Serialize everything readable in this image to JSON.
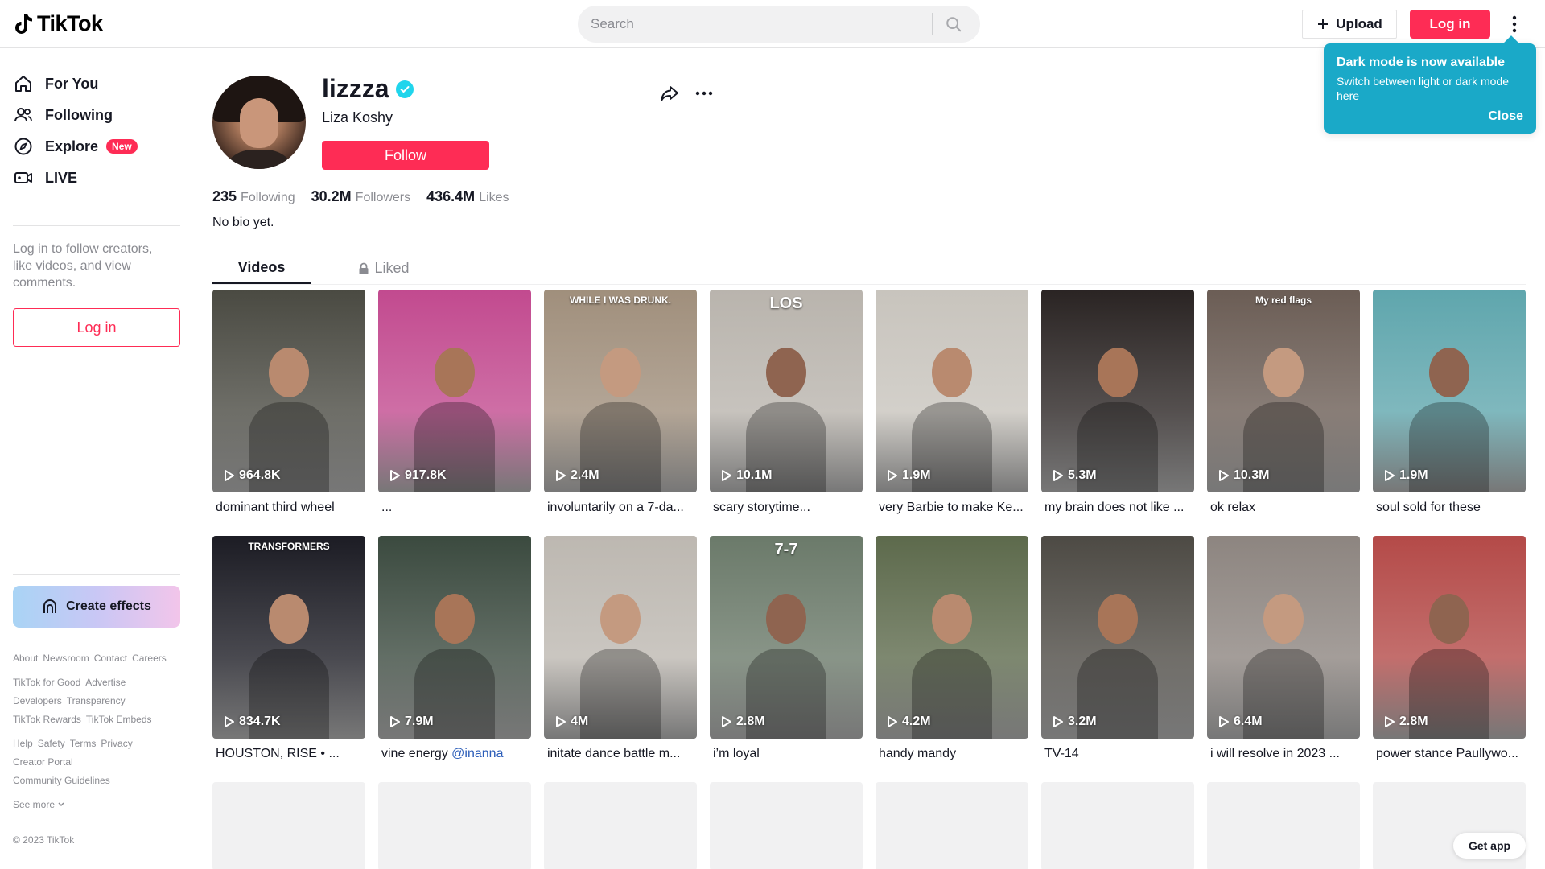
{
  "header": {
    "logo_text": "TikTok",
    "search_placeholder": "Search",
    "upload_label": "Upload",
    "login_label": "Log in"
  },
  "tooltip": {
    "title": "Dark mode is now available",
    "body": "Switch between light or dark mode here",
    "close_label": "Close"
  },
  "sidebar": {
    "nav": [
      {
        "label": "For You",
        "icon": "home-icon"
      },
      {
        "label": "Following",
        "icon": "people-icon"
      },
      {
        "label": "Explore",
        "icon": "compass-icon",
        "badge": "New"
      },
      {
        "label": "LIVE",
        "icon": "live-icon"
      }
    ],
    "login_prompt": "Log in to follow creators, like videos, and view comments.",
    "login_button": "Log in",
    "create_effects": "Create effects",
    "footer_rows": [
      [
        "About",
        "Newsroom",
        "Contact",
        "Careers"
      ],
      [
        "TikTok for Good",
        "Advertise"
      ],
      [
        "Developers",
        "Transparency"
      ],
      [
        "TikTok Rewards",
        "TikTok Embeds"
      ],
      [
        "Help",
        "Safety",
        "Terms",
        "Privacy"
      ],
      [
        "Creator Portal"
      ],
      [
        "Community Guidelines"
      ]
    ],
    "see_more": "See more",
    "copyright": "© 2023 TikTok"
  },
  "profile": {
    "username": "lizzza",
    "nickname": "Liza Koshy",
    "follow_label": "Follow",
    "stats": [
      {
        "value": "235",
        "label": "Following"
      },
      {
        "value": "30.2M",
        "label": "Followers"
      },
      {
        "value": "436.4M",
        "label": "Likes"
      }
    ],
    "bio": "No bio yet."
  },
  "tabs": {
    "videos": "Videos",
    "liked": "Liked"
  },
  "videos": [
    {
      "views": "964.8K",
      "caption": "dominant third wheel",
      "bg": "#4a4a42"
    },
    {
      "views": "917.8K",
      "caption": "...",
      "bg": "#c24a8f"
    },
    {
      "views": "2.4M",
      "caption": "involuntarily on a 7-da...",
      "bg": "#a08f7c",
      "overlay": "WHILE I WAS DRUNK."
    },
    {
      "views": "10.1M",
      "caption": "scary storytime...",
      "bg": "#b9b4ad",
      "overlay": "LOS"
    },
    {
      "views": "1.9M",
      "caption": "very Barbie to make Ke...",
      "bg": "#c8c4bd"
    },
    {
      "views": "5.3M",
      "caption": "my brain does not like ...",
      "bg": "#2a2423"
    },
    {
      "views": "10.3M",
      "caption": "ok relax",
      "bg": "#6b5d55",
      "overlay": "My red flags"
    },
    {
      "views": "1.9M",
      "caption": "soul sold for these",
      "bg": "#5fa6ad"
    },
    {
      "views": "834.7K",
      "caption": "HOUSTON, RISE • ...",
      "bg": "#1c1c24",
      "overlay": "TRANSFORMERS"
    },
    {
      "views": "7.9M",
      "caption": "vine energy",
      "mention": "@inanna",
      "bg": "#3b4a3f"
    },
    {
      "views": "4M",
      "caption": "initate dance battle m...",
      "bg": "#bdb8b1"
    },
    {
      "views": "2.8M",
      "caption": "i’m loyal",
      "bg": "#6b7a6a",
      "overlay": "7-7"
    },
    {
      "views": "4.2M",
      "caption": "handy mandy",
      "bg": "#5d6a4c"
    },
    {
      "views": "3.2M",
      "caption": "TV-14",
      "bg": "#4d4a44"
    },
    {
      "views": "6.4M",
      "caption": "i will resolve in 2023 ...",
      "bg": "#8d8580"
    },
    {
      "views": "2.8M",
      "caption": "power stance Paullywo...",
      "bg": "#b44a48"
    }
  ],
  "get_app": "Get app",
  "colors": {
    "brand": "#fe2c55",
    "tooltip": "#1aa9c8",
    "verified": "#20d5ec"
  }
}
